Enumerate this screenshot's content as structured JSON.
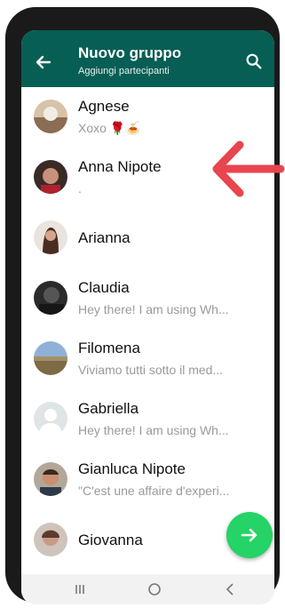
{
  "header": {
    "title": "Nuovo gruppo",
    "subtitle": "Aggiungi partecipanti",
    "back_icon": "arrow-left-icon",
    "search_icon": "search-icon"
  },
  "contacts": [
    {
      "name": "Agnese",
      "status": "Xoxo 🌹🍝",
      "avatar": "photo"
    },
    {
      "name": "Anna Nipote",
      "status": ".",
      "avatar": "photo"
    },
    {
      "name": "Arianna",
      "status": "",
      "avatar": "photo"
    },
    {
      "name": "Claudia",
      "status": "Hey there! I am using Wh...",
      "avatar": "photo"
    },
    {
      "name": "Filomena",
      "status": "Viviamo tutti sotto il med...",
      "avatar": "photo"
    },
    {
      "name": "Gabriella",
      "status": "Hey there! I am using Wh...",
      "avatar": "default"
    },
    {
      "name": "Gianluca Nipote",
      "status": "\"C'est une affaire d'experi...",
      "avatar": "photo"
    },
    {
      "name": "Giovanna",
      "status": "",
      "avatar": "photo"
    }
  ],
  "fab": {
    "icon": "arrow-right-icon"
  },
  "colors": {
    "header": "#075e54",
    "fab": "#25d366",
    "annotation": "#e8454e"
  }
}
